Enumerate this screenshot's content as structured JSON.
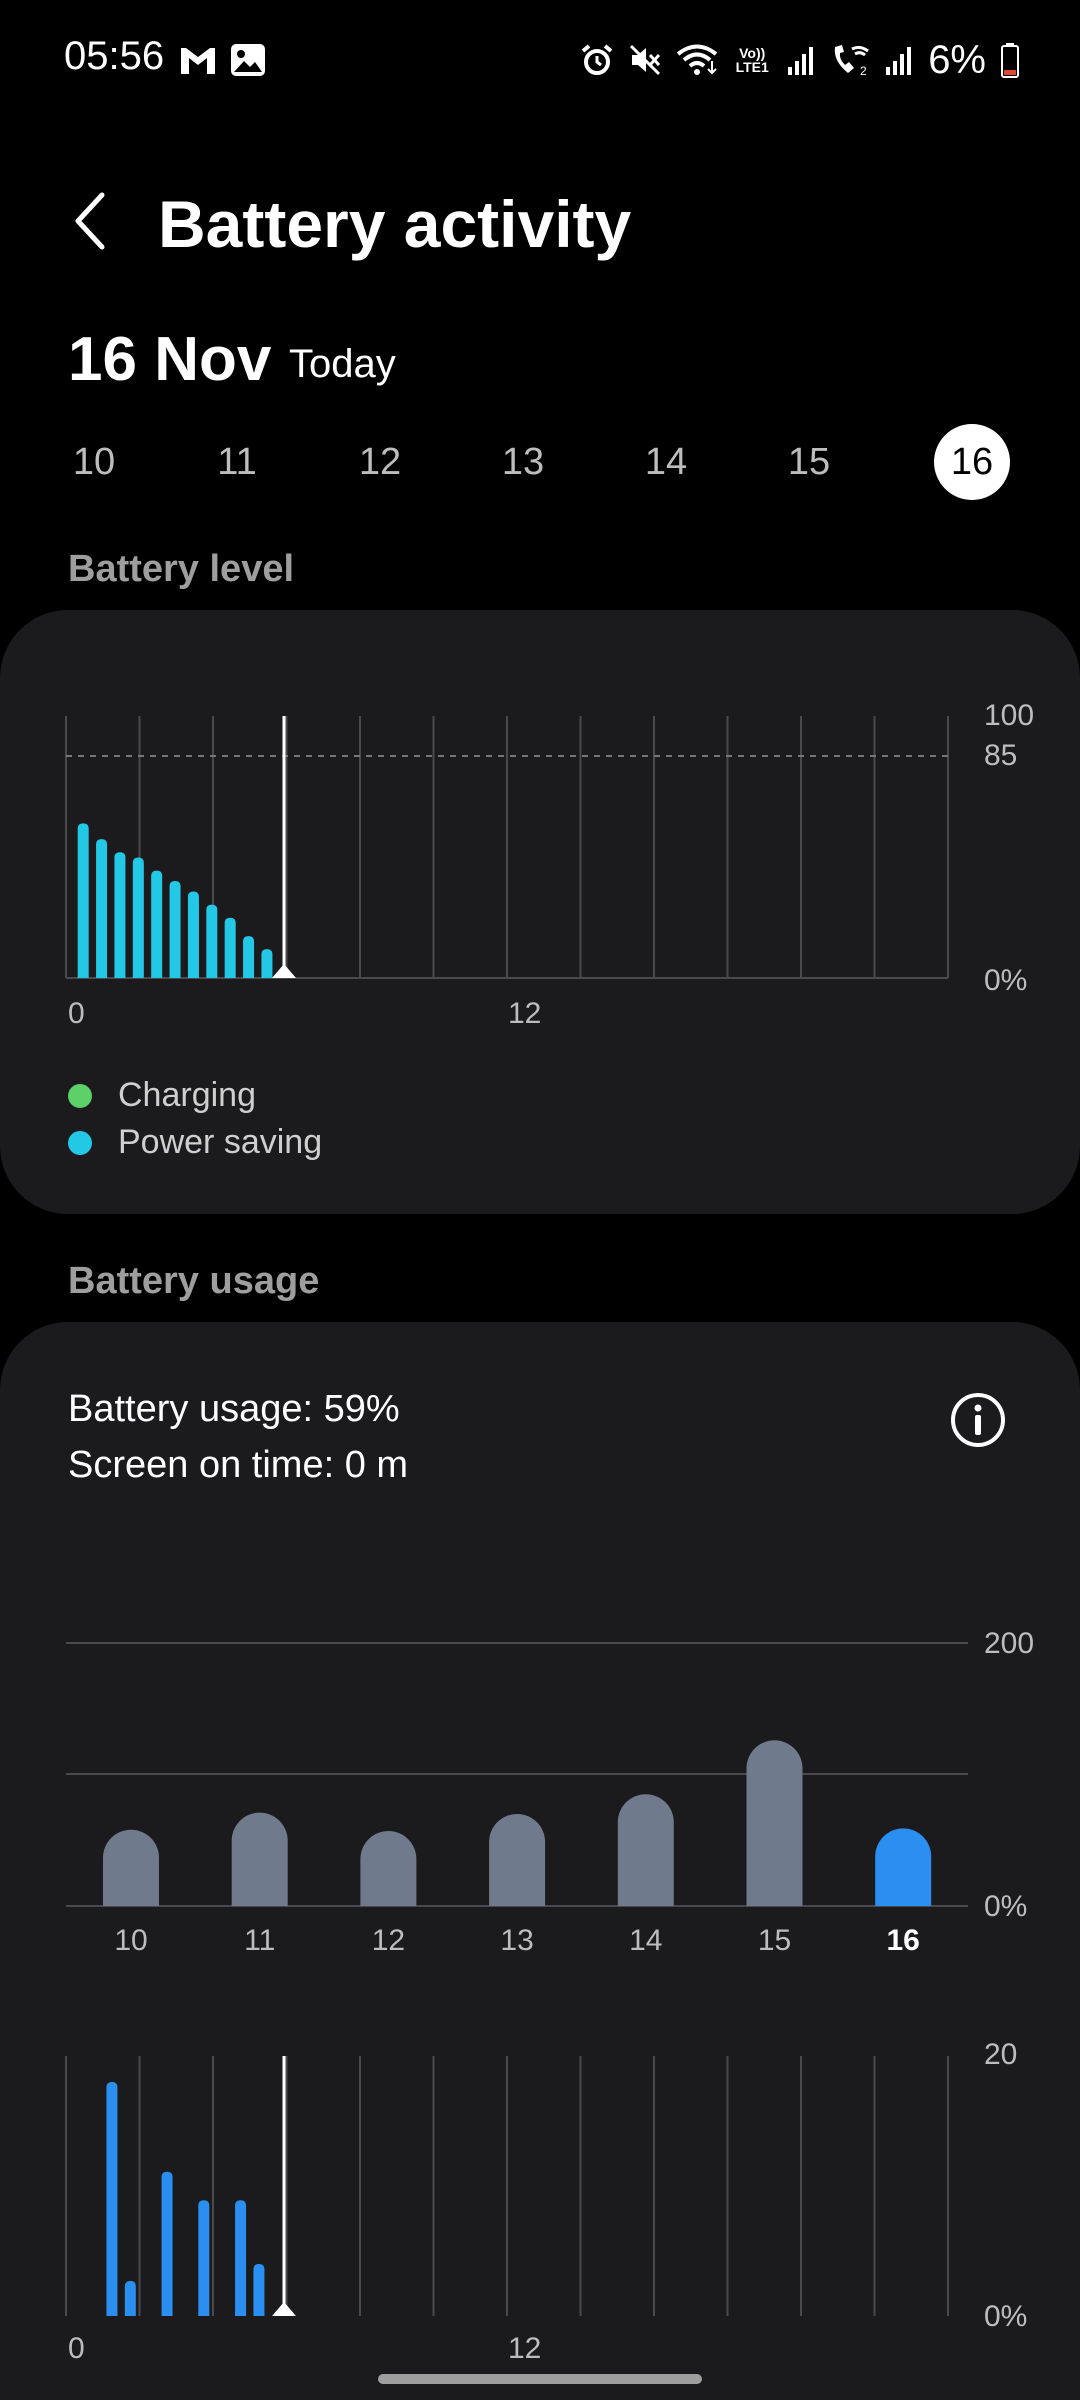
{
  "status_bar": {
    "time": "05:56",
    "notification_icons": [
      "gmail-icon",
      "gallery-icon"
    ],
    "system_icons": [
      "alarm-icon",
      "mute-icon",
      "wifi-icon",
      "volte-lte1-icon",
      "signal-icon",
      "wifi-calling-icon",
      "signal-2-icon"
    ],
    "volte_label": "Vo)) LTE1",
    "battery_percent": "6%"
  },
  "header": {
    "title": "Battery activity",
    "back_icon": "chevron-left-icon"
  },
  "date": {
    "main": "16 Nov",
    "sub": "Today"
  },
  "days": [
    "10",
    "11",
    "12",
    "13",
    "14",
    "15",
    "16"
  ],
  "selected_day": "16",
  "battery_level": {
    "section_label": "Battery level",
    "legend": [
      {
        "label": "Charging",
        "color": "#5cd16a"
      },
      {
        "label": "Power saving",
        "color": "#22c8e6"
      }
    ]
  },
  "battery_usage": {
    "section_label": "Battery usage",
    "usage_text": "Battery usage: 59%",
    "screen_on_text": "Screen on time: 0 m",
    "info_icon": "info-icon"
  },
  "colors": {
    "accent_cyan": "#22c8e6",
    "accent_blue": "#2a8ff0",
    "bar_grey": "#6f7a8c",
    "card_bg": "#1b1b1d"
  },
  "chart_data": [
    {
      "type": "bar",
      "title": "",
      "x_ticks": [
        "0",
        "12"
      ],
      "y_ticks": [
        "100",
        "85",
        "0%"
      ],
      "ylim": [
        0,
        100
      ],
      "reference_line": 85,
      "x_range_hours": [
        0,
        24
      ],
      "current_time_hour": 6,
      "series": [
        {
          "name": "Power saving",
          "color": "#22c8e6",
          "x": [
            0.25,
            0.75,
            1.25,
            1.75,
            2.25,
            2.75,
            3.25,
            3.75,
            4.25,
            4.75,
            5.25
          ],
          "values": [
            59,
            53,
            48,
            46,
            41,
            37,
            33,
            28,
            23,
            16,
            11
          ]
        }
      ],
      "grid": true
    },
    {
      "type": "bar",
      "title": "",
      "categories": [
        "10",
        "11",
        "12",
        "13",
        "14",
        "15",
        "16"
      ],
      "values": [
        58,
        71,
        57,
        70,
        85,
        126,
        59
      ],
      "y_ticks": [
        "200",
        "0%"
      ],
      "ylim": [
        0,
        200
      ],
      "highlight_category": "16",
      "grid": true
    },
    {
      "type": "bar",
      "title": "",
      "x_ticks": [
        "0",
        "12"
      ],
      "y_ticks": [
        "20",
        "0%"
      ],
      "ylim": [
        0,
        20
      ],
      "x_range_hours": [
        0,
        24
      ],
      "current_time_hour": 6,
      "series": [
        {
          "color": "#2a8ff0",
          "x": [
            1.25,
            1.75,
            2.75,
            3.75,
            4.75,
            5.25
          ],
          "values": [
            18,
            2.7,
            11.1,
            8.9,
            8.9,
            4
          ]
        }
      ],
      "grid": true
    }
  ]
}
